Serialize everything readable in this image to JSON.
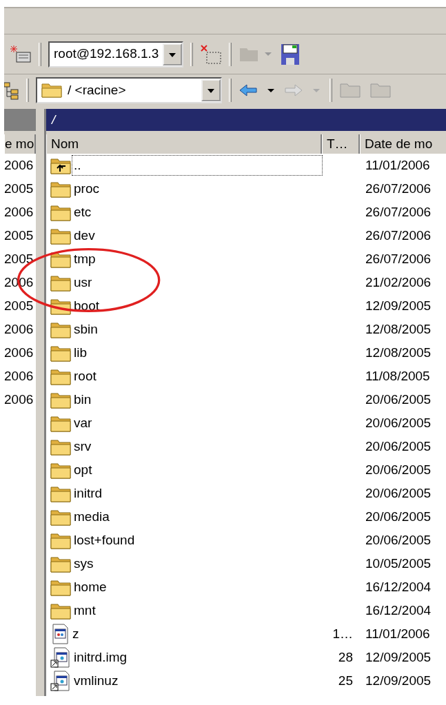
{
  "toolbar": {
    "session": "root@192.168.1.3"
  },
  "path_combo": {
    "value": "/ <racine>"
  },
  "path_bar": {
    "path": "/"
  },
  "left_pane": {
    "column": "e mo",
    "dates": [
      "2006",
      "2005",
      "2006",
      "2005",
      "2005",
      "2006",
      "2005",
      "2006",
      "2006",
      "2006",
      "2006"
    ]
  },
  "remote_pane": {
    "columns": [
      "Nom",
      "T…",
      "Date de mo"
    ],
    "rows": [
      {
        "kind": "parent",
        "name": "..",
        "date": "11/01/2006",
        "focused": true
      },
      {
        "kind": "folder",
        "name": "proc",
        "date": "26/07/2006",
        "focused": false
      },
      {
        "kind": "folder",
        "name": "etc",
        "date": "26/07/2006",
        "focused": false
      },
      {
        "kind": "folder",
        "name": "dev",
        "date": "26/07/2006",
        "focused": false
      },
      {
        "kind": "folder",
        "name": "tmp",
        "date": "26/07/2006",
        "focused": false
      },
      {
        "kind": "folder",
        "name": "usr",
        "date": "21/02/2006",
        "focused": false
      },
      {
        "kind": "folder",
        "name": "boot",
        "date": "12/09/2005",
        "focused": false
      },
      {
        "kind": "folder",
        "name": "sbin",
        "date": "12/08/2005",
        "focused": false
      },
      {
        "kind": "folder",
        "name": "lib",
        "date": "12/08/2005",
        "focused": false
      },
      {
        "kind": "folder",
        "name": "root",
        "date": "11/08/2005",
        "focused": false
      },
      {
        "kind": "folder",
        "name": "bin",
        "date": "20/06/2005",
        "focused": false
      },
      {
        "kind": "folder",
        "name": "var",
        "date": "20/06/2005",
        "focused": false
      },
      {
        "kind": "folder",
        "name": "srv",
        "date": "20/06/2005",
        "focused": false
      },
      {
        "kind": "folder",
        "name": "opt",
        "date": "20/06/2005",
        "focused": false
      },
      {
        "kind": "folder",
        "name": "initrd",
        "date": "20/06/2005",
        "focused": false
      },
      {
        "kind": "folder",
        "name": "media",
        "date": "20/06/2005",
        "focused": false
      },
      {
        "kind": "folder",
        "name": "lost+found",
        "date": "20/06/2005",
        "focused": false
      },
      {
        "kind": "folder",
        "name": "sys",
        "date": "10/05/2005",
        "focused": false
      },
      {
        "kind": "folder",
        "name": "home",
        "date": "16/12/2004",
        "focused": false
      },
      {
        "kind": "folder",
        "name": "mnt",
        "date": "16/12/2004",
        "focused": false
      },
      {
        "kind": "file",
        "name": "z",
        "size": "1…",
        "date": "11/01/2006",
        "focused": false
      },
      {
        "kind": "link",
        "name": "initrd.img",
        "size": "28",
        "date": "12/09/2005",
        "focused": false
      },
      {
        "kind": "link",
        "name": "vmlinuz",
        "size": "25",
        "date": "12/09/2005",
        "focused": false
      }
    ]
  }
}
